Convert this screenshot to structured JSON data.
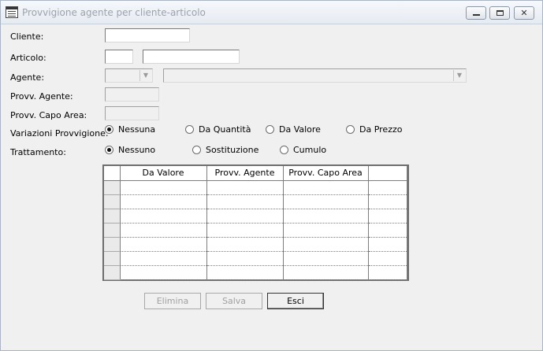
{
  "window": {
    "title": "Provvigione agente per cliente-articolo",
    "controls": {
      "minimize": "-",
      "maximize": "",
      "close": "✕"
    }
  },
  "form": {
    "cliente_label": "Cliente:",
    "cliente_value": "",
    "articolo_label": "Articolo:",
    "articolo_code": "",
    "articolo_desc": "",
    "agente_label": "Agente:",
    "agente_code": "",
    "agente_name": "",
    "provv_agente_label": "Provv. Agente:",
    "provv_agente_value": "",
    "provv_capo_label": "Provv. Capo Area:",
    "provv_capo_value": "",
    "variazioni_label": "Variazioni Provvigione:",
    "variazioni_options": [
      {
        "label": "Nessuna",
        "selected": true
      },
      {
        "label": "Da Quantità",
        "selected": false
      },
      {
        "label": "Da Valore",
        "selected": false
      },
      {
        "label": "Da Prezzo",
        "selected": false
      }
    ],
    "trattamento_label": "Trattamento:",
    "trattamento_options": [
      {
        "label": "Nessuno",
        "selected": true
      },
      {
        "label": "Sostituzione",
        "selected": false
      },
      {
        "label": "Cumulo",
        "selected": false
      }
    ]
  },
  "grid": {
    "columns": [
      "Da Valore",
      "Provv. Agente",
      "Provv. Capo Area",
      ""
    ],
    "rows": [
      [
        "",
        "",
        "",
        ""
      ],
      [
        "",
        "",
        "",
        ""
      ],
      [
        "",
        "",
        "",
        ""
      ],
      [
        "",
        "",
        "",
        ""
      ],
      [
        "",
        "",
        "",
        ""
      ],
      [
        "",
        "",
        "",
        ""
      ],
      [
        "",
        "",
        "",
        ""
      ]
    ]
  },
  "buttons": {
    "elimina": {
      "label": "Elimina",
      "enabled": false
    },
    "salva": {
      "label": "Salva",
      "enabled": false
    },
    "esci": {
      "label": "Esci",
      "enabled": true
    }
  }
}
